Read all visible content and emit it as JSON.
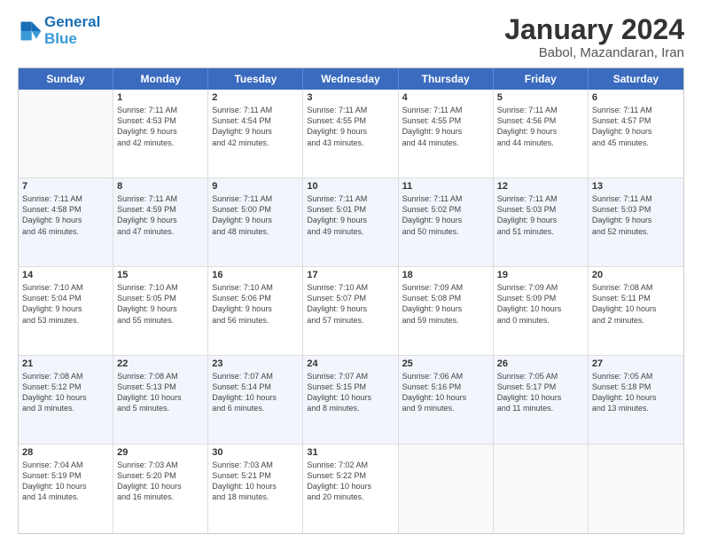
{
  "header": {
    "logo_line1": "General",
    "logo_line2": "Blue",
    "title": "January 2024",
    "subtitle": "Babol, Mazandaran, Iran"
  },
  "calendar": {
    "days_of_week": [
      "Sunday",
      "Monday",
      "Tuesday",
      "Wednesday",
      "Thursday",
      "Friday",
      "Saturday"
    ],
    "weeks": [
      [
        {
          "day": "",
          "empty": true
        },
        {
          "day": "1",
          "sunrise": "7:11 AM",
          "sunset": "4:53 PM",
          "daylight": "9 hours and 42 minutes."
        },
        {
          "day": "2",
          "sunrise": "7:11 AM",
          "sunset": "4:54 PM",
          "daylight": "9 hours and 42 minutes."
        },
        {
          "day": "3",
          "sunrise": "7:11 AM",
          "sunset": "4:55 PM",
          "daylight": "9 hours and 43 minutes."
        },
        {
          "day": "4",
          "sunrise": "7:11 AM",
          "sunset": "4:55 PM",
          "daylight": "9 hours and 44 minutes."
        },
        {
          "day": "5",
          "sunrise": "7:11 AM",
          "sunset": "4:56 PM",
          "daylight": "9 hours and 44 minutes."
        },
        {
          "day": "6",
          "sunrise": "7:11 AM",
          "sunset": "4:57 PM",
          "daylight": "9 hours and 45 minutes."
        }
      ],
      [
        {
          "day": "7",
          "sunrise": "7:11 AM",
          "sunset": "4:58 PM",
          "daylight": "9 hours and 46 minutes."
        },
        {
          "day": "8",
          "sunrise": "7:11 AM",
          "sunset": "4:59 PM",
          "daylight": "9 hours and 47 minutes."
        },
        {
          "day": "9",
          "sunrise": "7:11 AM",
          "sunset": "5:00 PM",
          "daylight": "9 hours and 48 minutes."
        },
        {
          "day": "10",
          "sunrise": "7:11 AM",
          "sunset": "5:01 PM",
          "daylight": "9 hours and 49 minutes."
        },
        {
          "day": "11",
          "sunrise": "7:11 AM",
          "sunset": "5:02 PM",
          "daylight": "9 hours and 50 minutes."
        },
        {
          "day": "12",
          "sunrise": "7:11 AM",
          "sunset": "5:03 PM",
          "daylight": "9 hours and 51 minutes."
        },
        {
          "day": "13",
          "sunrise": "7:11 AM",
          "sunset": "5:03 PM",
          "daylight": "9 hours and 52 minutes."
        }
      ],
      [
        {
          "day": "14",
          "sunrise": "7:10 AM",
          "sunset": "5:04 PM",
          "daylight": "9 hours and 53 minutes."
        },
        {
          "day": "15",
          "sunrise": "7:10 AM",
          "sunset": "5:05 PM",
          "daylight": "9 hours and 55 minutes."
        },
        {
          "day": "16",
          "sunrise": "7:10 AM",
          "sunset": "5:06 PM",
          "daylight": "9 hours and 56 minutes."
        },
        {
          "day": "17",
          "sunrise": "7:10 AM",
          "sunset": "5:07 PM",
          "daylight": "9 hours and 57 minutes."
        },
        {
          "day": "18",
          "sunrise": "7:09 AM",
          "sunset": "5:08 PM",
          "daylight": "9 hours and 59 minutes."
        },
        {
          "day": "19",
          "sunrise": "7:09 AM",
          "sunset": "5:09 PM",
          "daylight": "10 hours and 0 minutes."
        },
        {
          "day": "20",
          "sunrise": "7:08 AM",
          "sunset": "5:11 PM",
          "daylight": "10 hours and 2 minutes."
        }
      ],
      [
        {
          "day": "21",
          "sunrise": "7:08 AM",
          "sunset": "5:12 PM",
          "daylight": "10 hours and 3 minutes."
        },
        {
          "day": "22",
          "sunrise": "7:08 AM",
          "sunset": "5:13 PM",
          "daylight": "10 hours and 5 minutes."
        },
        {
          "day": "23",
          "sunrise": "7:07 AM",
          "sunset": "5:14 PM",
          "daylight": "10 hours and 6 minutes."
        },
        {
          "day": "24",
          "sunrise": "7:07 AM",
          "sunset": "5:15 PM",
          "daylight": "10 hours and 8 minutes."
        },
        {
          "day": "25",
          "sunrise": "7:06 AM",
          "sunset": "5:16 PM",
          "daylight": "10 hours and 9 minutes."
        },
        {
          "day": "26",
          "sunrise": "7:05 AM",
          "sunset": "5:17 PM",
          "daylight": "10 hours and 11 minutes."
        },
        {
          "day": "27",
          "sunrise": "7:05 AM",
          "sunset": "5:18 PM",
          "daylight": "10 hours and 13 minutes."
        }
      ],
      [
        {
          "day": "28",
          "sunrise": "7:04 AM",
          "sunset": "5:19 PM",
          "daylight": "10 hours and 14 minutes."
        },
        {
          "day": "29",
          "sunrise": "7:03 AM",
          "sunset": "5:20 PM",
          "daylight": "10 hours and 16 minutes."
        },
        {
          "day": "30",
          "sunrise": "7:03 AM",
          "sunset": "5:21 PM",
          "daylight": "10 hours and 18 minutes."
        },
        {
          "day": "31",
          "sunrise": "7:02 AM",
          "sunset": "5:22 PM",
          "daylight": "10 hours and 20 minutes."
        },
        {
          "day": "",
          "empty": true
        },
        {
          "day": "",
          "empty": true
        },
        {
          "day": "",
          "empty": true
        }
      ]
    ]
  }
}
